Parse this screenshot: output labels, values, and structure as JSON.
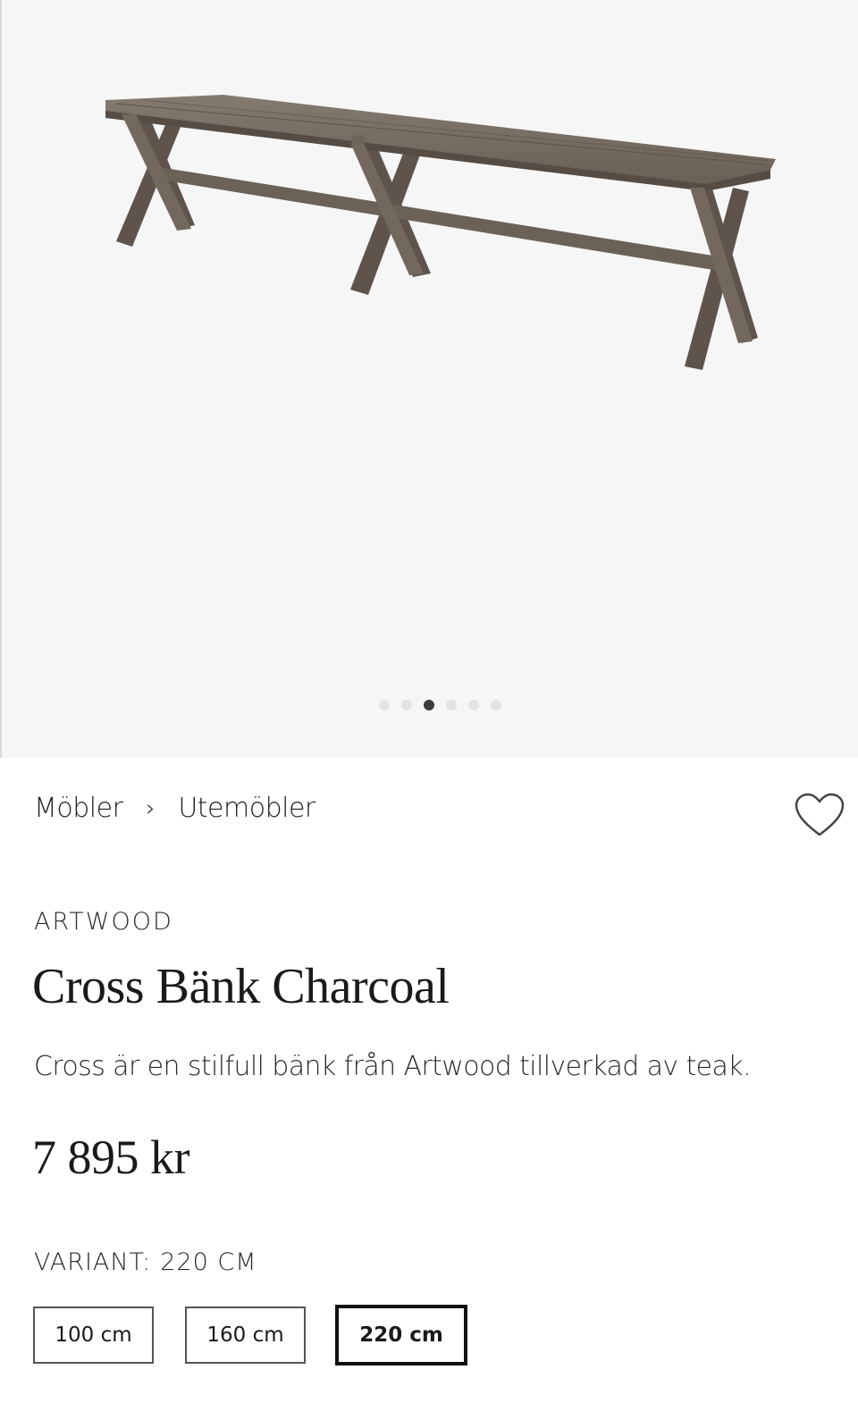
{
  "gallery": {
    "image_alt": "Cross Bänk Charcoal",
    "dot_count": 6,
    "active_index": 2
  },
  "breadcrumb": {
    "items": [
      "Möbler",
      "Utemöbler"
    ],
    "separator": "›"
  },
  "product": {
    "brand": "ARTWOOD",
    "title": "Cross Bänk Charcoal",
    "description": "Cross är en stilfull bänk från Artwood tillverkad av teak.",
    "price": "7 895 kr"
  },
  "variant": {
    "label": "VARIANT:",
    "selected": "220 CM",
    "options": [
      "100 cm",
      "160 cm",
      "220 cm"
    ],
    "selected_index": 2
  },
  "icons": {
    "wishlist": "heart-outline-icon"
  },
  "colors": {
    "gallery_bg": "#f6f6f6",
    "wood": "#6f6459",
    "text": "#1a1a1a"
  }
}
